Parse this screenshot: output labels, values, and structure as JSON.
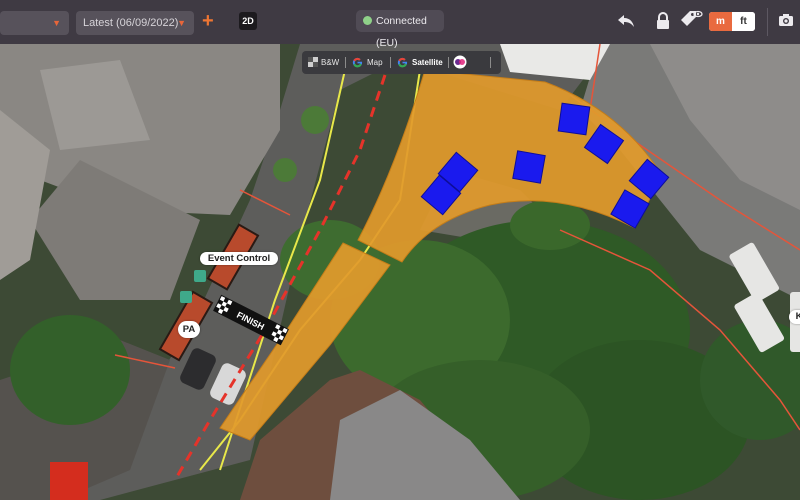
{
  "toolbar": {
    "date_select": "Latest (06/09/2022)",
    "add_icon": "plus-icon",
    "view_mode": "2D",
    "status": "Connected (EU)",
    "status_color": "#8fd189",
    "unit_metric": "m",
    "unit_imperial": "ft",
    "accent": "#e96a3f"
  },
  "layers": {
    "bw": "B&W",
    "map": "Map",
    "satellite": "Satellite"
  },
  "map": {
    "event_control": "Event Control",
    "finish": "FINISH",
    "pa": "PA",
    "k": "K",
    "zone_color": "#e19a2c",
    "block_color": "#1a1aee"
  }
}
